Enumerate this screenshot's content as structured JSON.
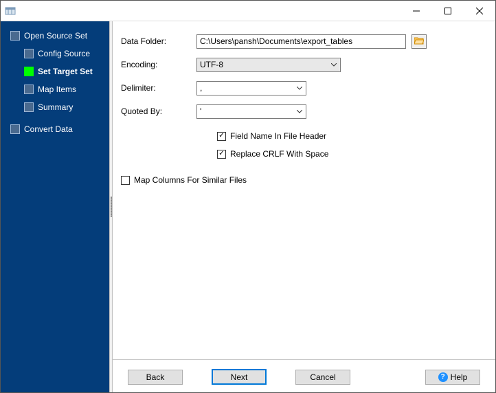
{
  "sidebar": {
    "items": [
      {
        "label": "Open Source Set",
        "level": 0,
        "active": false
      },
      {
        "label": "Config Source",
        "level": 1,
        "active": false
      },
      {
        "label": "Set Target Set",
        "level": 1,
        "active": true
      },
      {
        "label": "Map Items",
        "level": 1,
        "active": false
      },
      {
        "label": "Summary",
        "level": 1,
        "active": false
      },
      {
        "label": "Convert Data",
        "level": 0,
        "active": false
      }
    ]
  },
  "form": {
    "dataFolder": {
      "label": "Data Folder:",
      "value": "C:\\Users\\pansh\\Documents\\export_tables"
    },
    "encoding": {
      "label": "Encoding:",
      "value": "UTF-8"
    },
    "delimiter": {
      "label": "Delimiter:",
      "value": ","
    },
    "quotedBy": {
      "label": "Quoted By:",
      "value": "'"
    },
    "fieldHeader": {
      "label": "Field Name In File Header",
      "checked": true
    },
    "replaceCrlf": {
      "label": "Replace CRLF With Space",
      "checked": true
    },
    "mapCols": {
      "label": "Map Columns For Similar Files",
      "checked": false
    }
  },
  "buttons": {
    "back": "Back",
    "next": "Next",
    "cancel": "Cancel",
    "help": "Help"
  }
}
